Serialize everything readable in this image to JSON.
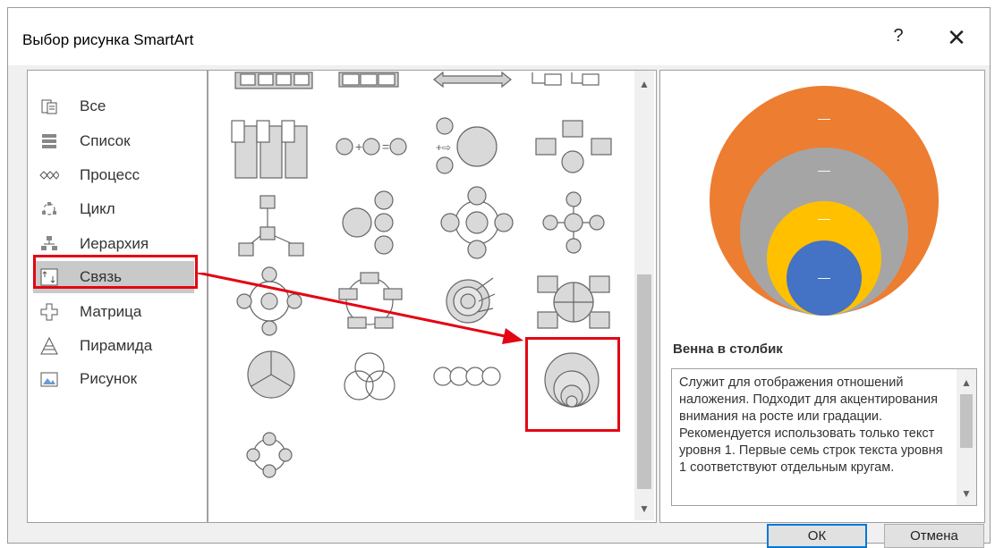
{
  "window": {
    "title": "Выбор рисунка SmartArt",
    "help_glyph": "?",
    "close_glyph": "✕"
  },
  "categories": [
    {
      "label": "Все",
      "icon": "all-icon"
    },
    {
      "label": "Список",
      "icon": "list-icon"
    },
    {
      "label": "Процесс",
      "icon": "process-icon"
    },
    {
      "label": "Цикл",
      "icon": "cycle-icon"
    },
    {
      "label": "Иерархия",
      "icon": "hierarchy-icon"
    },
    {
      "label": "Связь",
      "icon": "relationship-icon",
      "selected": true
    },
    {
      "label": "Матрица",
      "icon": "matrix-icon"
    },
    {
      "label": "Пирамида",
      "icon": "pyramid-icon"
    },
    {
      "label": "Рисунок",
      "icon": "picture-icon"
    }
  ],
  "preview": {
    "title": "Венна в столбик",
    "description": "Служит для отображения отношений наложения. Подходит для акцентирования внимания на росте или градации. Рекомендуется использовать только текст уровня 1. Первые семь строк текста уровня 1 соответствуют отдельным кругам.",
    "circle_label": "—",
    "colors": [
      "#ed7d31",
      "#a5a5a5",
      "#ffc000",
      "#4472c4"
    ]
  },
  "buttons": {
    "ok": "ОК",
    "cancel": "Отмена"
  },
  "annotation_color": "#e30613"
}
